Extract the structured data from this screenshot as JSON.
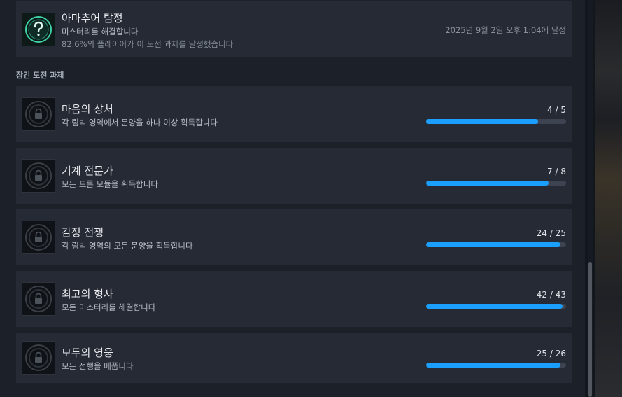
{
  "unlocked": {
    "title": "아마추어 탐정",
    "description": "미스터리를 해결합니다",
    "global_pct": "82.6%의 플레이어가 이 도전 과제를 달성했습니다",
    "unlock_date": "2025년 9월 2일 오후 1:04에 달성",
    "icon": "question-mark-icon"
  },
  "section_title": "잠긴 도전 과제",
  "locked": [
    {
      "title": "마음의 상처",
      "description": "각 림빅 영역에서 문양을 하나 이상 획득합니다",
      "progress_text": "4 / 5",
      "progress": 0.8,
      "icon": "lock-icon"
    },
    {
      "title": "기계 전문가",
      "description": "모든 드론 모듈을 획득합니다",
      "progress_text": "7 / 8",
      "progress": 0.875,
      "icon": "lock-icon"
    },
    {
      "title": "감정 전쟁",
      "description": "각 림빅 영역의 모든 문양을 획득합니다",
      "progress_text": "24 / 25",
      "progress": 0.96,
      "icon": "lock-icon"
    },
    {
      "title": "최고의 형사",
      "description": "모든 미스터리를 해결합니다",
      "progress_text": "42 / 43",
      "progress": 0.977,
      "icon": "lock-icon"
    },
    {
      "title": "모두의 영웅",
      "description": "모든 선행을 베풉니다",
      "progress_text": "25 / 26",
      "progress": 0.962,
      "icon": "lock-icon"
    }
  ],
  "colors": {
    "accent": "#1a9fff",
    "card": "#262a35",
    "background": "#1b2029"
  }
}
